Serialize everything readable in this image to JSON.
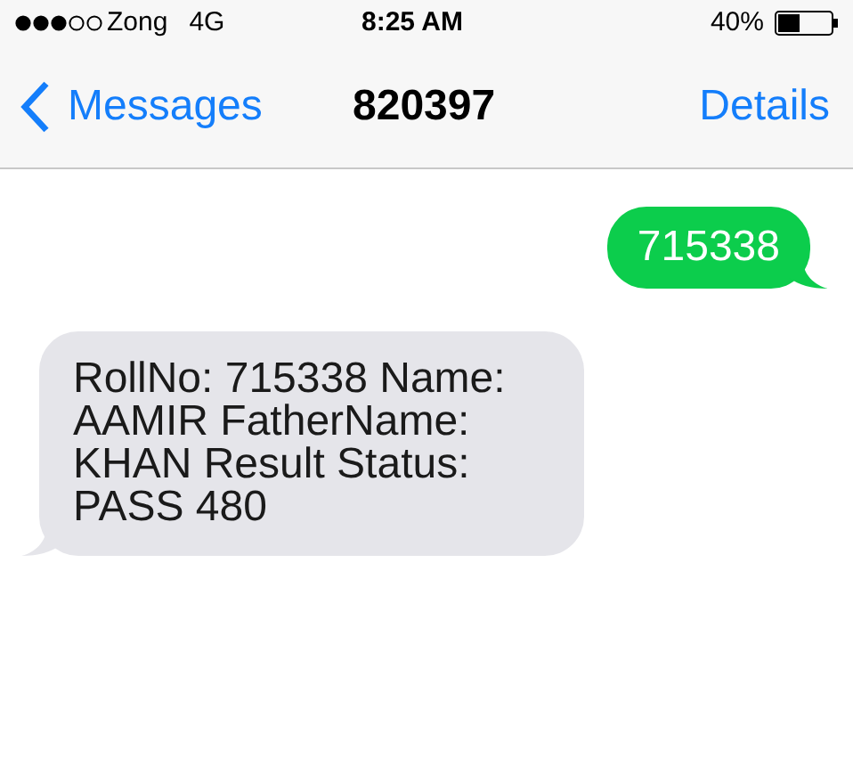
{
  "status_bar": {
    "carrier": "Zong",
    "network": "4G",
    "time": "8:25 AM",
    "battery": "40%"
  },
  "nav": {
    "back": "Messages",
    "title": "820397",
    "action": "Details"
  },
  "messages": [
    {
      "kind": "sent",
      "text": "715338"
    },
    {
      "kind": "received",
      "text": "RollNo: 715338 Name: AAMIR FatherName: KHAN Result Status: PASS 480"
    }
  ]
}
